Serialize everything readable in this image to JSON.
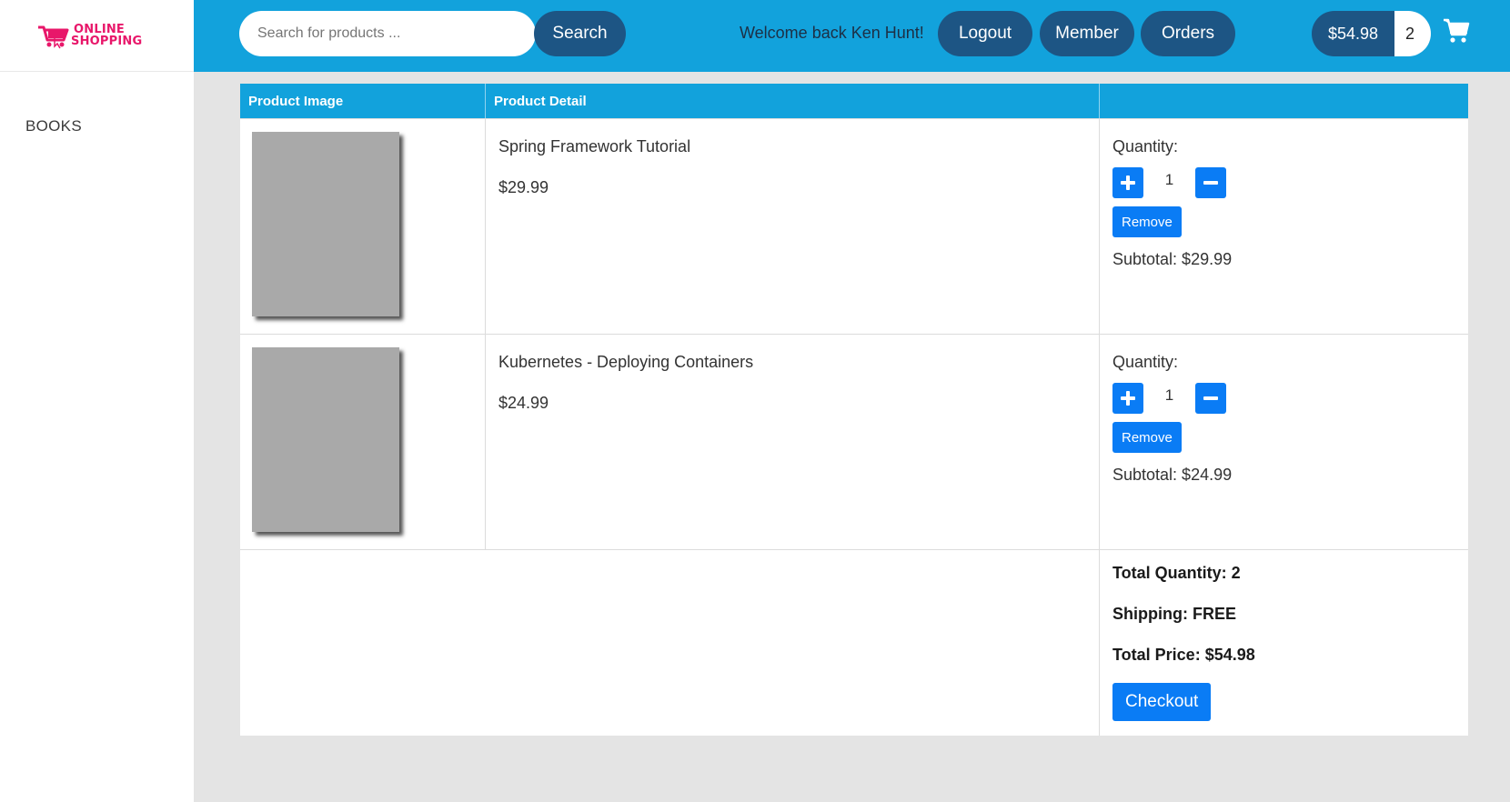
{
  "logo": {
    "line1": "ONLINE",
    "line2": "SHOPPING"
  },
  "sidebar": {
    "items": [
      {
        "label": "BOOKS"
      }
    ]
  },
  "header": {
    "search_placeholder": "Search for products ...",
    "search_button": "Search",
    "welcome": "Welcome back Ken Hunt!",
    "logout": "Logout",
    "member": "Member",
    "orders": "Orders",
    "cart_total": "$54.98",
    "cart_count": "2",
    "cart_icon": "shopping-cart-icon"
  },
  "table": {
    "headers": [
      "Product Image",
      "Product Detail",
      ""
    ],
    "quantity_label": "Quantity:",
    "remove_label": "Remove",
    "items": [
      {
        "name": "Spring Framework Tutorial",
        "price": "$29.99",
        "quantity": "1",
        "subtotal": "Subtotal: $29.99"
      },
      {
        "name": "Kubernetes - Deploying Containers",
        "price": "$24.99",
        "quantity": "1",
        "subtotal": "Subtotal: $24.99"
      }
    ],
    "summary": {
      "total_quantity": "Total Quantity: 2",
      "shipping": "Shipping: FREE",
      "total_price": "Total Price: $54.98",
      "checkout": "Checkout"
    }
  },
  "colors": {
    "header_bg": "#12a2dc",
    "pill_bg": "#1d5584",
    "button_blue": "#0a7cf5",
    "logo_pink": "#e8176a"
  }
}
